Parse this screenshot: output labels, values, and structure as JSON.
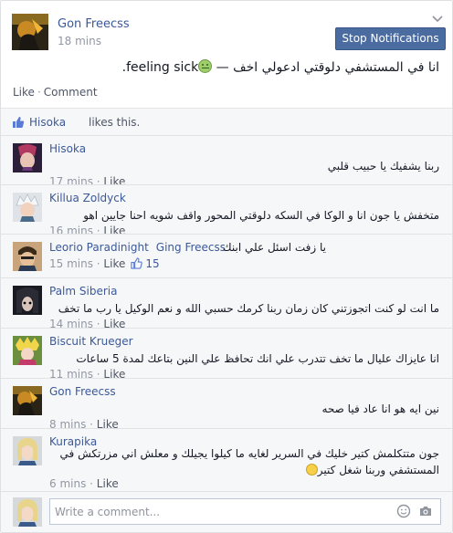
{
  "post": {
    "author": "Gon Freecss",
    "time": "18 mins",
    "stop_button": "Stop Notifications",
    "text_main": "انا في المستشفي دلوقتي ادعولي اخف — ",
    "feeling": "feeling sick.",
    "actions": {
      "like": "Like",
      "comment": "Comment"
    }
  },
  "likes": {
    "liker": "Hisoka",
    "rest": "likes this."
  },
  "comments": [
    {
      "name": "Hisoka",
      "tag": "",
      "text": "ربنا يشفيك يا حبيب قلبي",
      "time": "17 mins",
      "like": "Like",
      "like_count": ""
    },
    {
      "name": "Killua Zoldyck",
      "tag": "",
      "text": "متخفش يا جون انا و الوكا في السكه دلوقتي المحور واقف شويه احنا جايين اهو",
      "time": "16 mins",
      "like": "Like",
      "like_count": ""
    },
    {
      "name": "Leorio Paradinight",
      "tag": "Ging Freecss",
      "text": "يا زفت اسئل علي ابنك",
      "time": "15 mins",
      "like": "Like",
      "like_count": "15"
    },
    {
      "name": "Palm Siberia",
      "tag": "",
      "text": "ما انت لو كنت اتجوزتني كان زمان ربنا كرمك حسبي الله و نعم الوكيل يا رب ما تخف",
      "time": "14 mins",
      "like": "Like",
      "like_count": ""
    },
    {
      "name": "Biscuit Krueger",
      "tag": "",
      "text": "انا عايزاك عليال ما تخف تتدرب علي انك تحافظ علي النين بتاعك لمدة 5 ساعات",
      "time": "11 mins",
      "like": "Like",
      "like_count": ""
    },
    {
      "name": "Gon Freecss",
      "tag": "",
      "text": "نين ايه هو انا عاد فيا صحه",
      "time": "8 mins",
      "like": "Like",
      "like_count": ""
    },
    {
      "name": "Kurapika",
      "tag": "",
      "text": "جون متتكلمش كتير خليك في السرير لغايه ما كيلوا يجيلك و معلش اني مزرتكش في المستشفي وربنا شغل كتير",
      "time": "6 mins",
      "like": "Like",
      "like_count": ""
    }
  ],
  "write": {
    "placeholder": "Write a comment..."
  },
  "icons": {
    "chevron": "chevron-down-icon",
    "like_thumb": "thumbs-up-icon",
    "camera": "camera-icon",
    "emoji": "smiley-icon"
  },
  "colors": {
    "link": "#3b5998",
    "button": "#4b6ca0",
    "muted": "#9197a3"
  }
}
